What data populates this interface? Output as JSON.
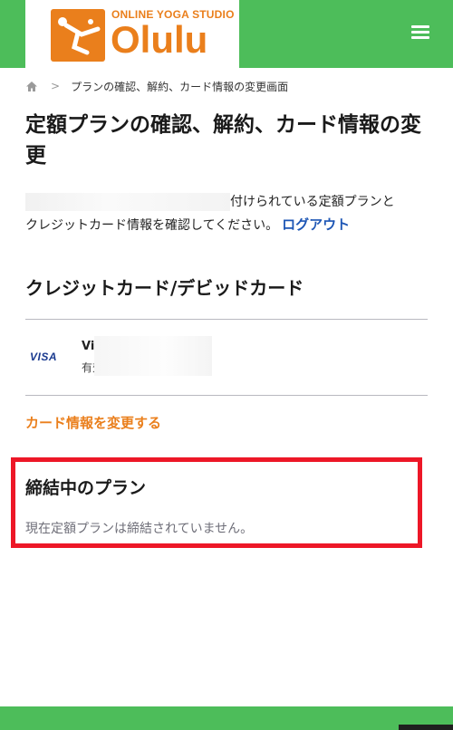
{
  "header": {
    "logo_subtitle": "ONLINE YOGA STUDIO",
    "logo_title": "Olulu",
    "brand_color": "#ea7f1c",
    "header_color": "#4dbd5a",
    "menu_icon": "hamburger-menu-icon"
  },
  "breadcrumb": {
    "home_icon": "home-icon",
    "separator": ">",
    "current": "プランの確認、解約、カード情報の変更画面"
  },
  "page": {
    "title": "定額プランの確認、解約、カード情報の変更",
    "intro_line1": "付けられている定額プランと",
    "intro_line2": "クレジットカード情報を確認してください。",
    "logout_label": "ログアウト",
    "logout_color": "#1d56b5"
  },
  "card_section": {
    "heading": "クレジットカード/デビッドカード",
    "brand": "VISA",
    "card_name": "Vi",
    "expiry_label": "有効期限"
  },
  "change_card_label": "カード情報を変更する",
  "plan_section": {
    "heading": "締結中のプラン",
    "status": "現在定額プランは締結されていません。",
    "highlight_color": "#ed1727"
  }
}
